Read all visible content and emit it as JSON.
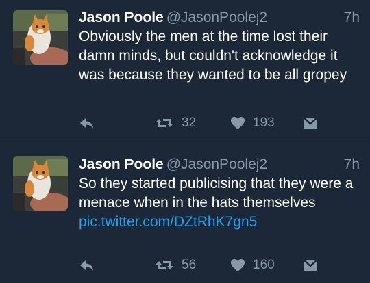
{
  "tweets": [
    {
      "name": "Jason Poole",
      "handle": "@JasonPoolej2",
      "time": "7h",
      "text": "Obviously the men at the time lost their damn minds, but couldn't acknowledge it was because they wanted to be all gropey",
      "link": "",
      "retweets": "32",
      "likes": "193"
    },
    {
      "name": "Jason Poole",
      "handle": "@JasonPoolej2",
      "time": "7h",
      "text": "So they started publicising that they were a menace when in the hats themselves ",
      "link": "pic.twitter.com/DZtRhK7gn5",
      "retweets": "56",
      "likes": "160"
    }
  ],
  "icons": {
    "reply": "reply-icon",
    "retweet": "retweet-icon",
    "like": "heart-icon",
    "dm": "direct-message-icon"
  },
  "colors": {
    "background": "#1c2838",
    "secondary_text": "#8899a6",
    "link": "#1da1f2",
    "divider": "#38444d"
  }
}
